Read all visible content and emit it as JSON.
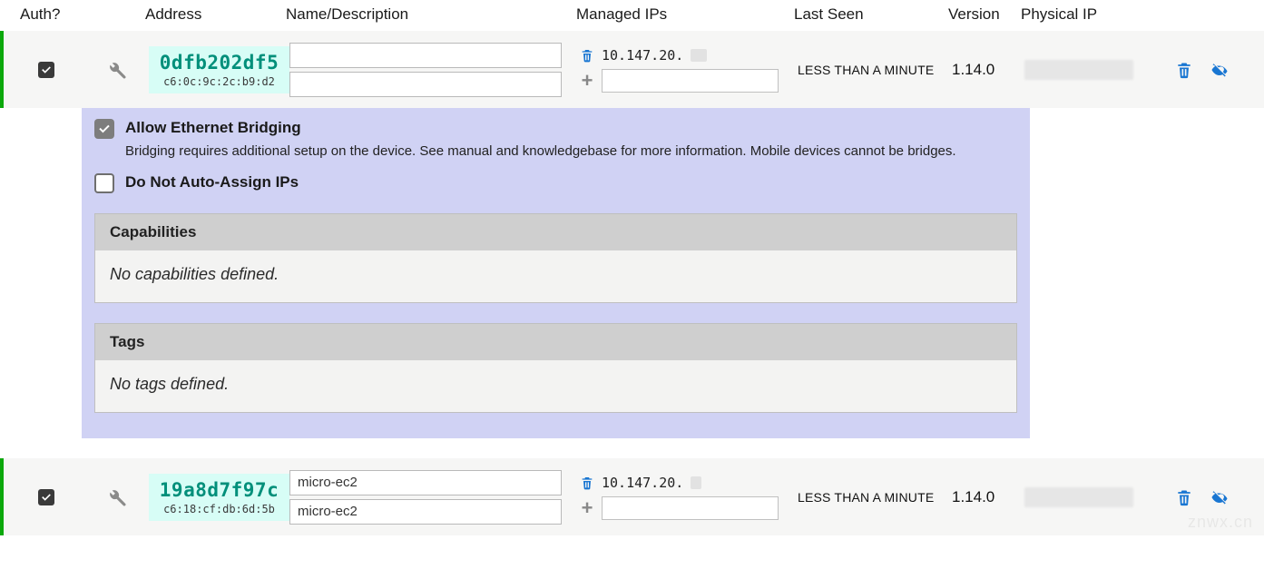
{
  "columns": {
    "auth": "Auth?",
    "address": "Address",
    "name": "Name/Description",
    "ips": "Managed IPs",
    "seen": "Last Seen",
    "version": "Version",
    "physical": "Physical IP"
  },
  "members": [
    {
      "authorized": true,
      "node_id": "0dfb202df5",
      "mac": "c6:0c:9c:2c:b9:d2",
      "name": "",
      "description": "",
      "managed_ips": [
        "10.147.20."
      ],
      "new_ip_value": "",
      "last_seen": "LESS THAN A MINUTE",
      "version": "1.14.0",
      "physical_ip_hidden": true,
      "expanded": true
    },
    {
      "authorized": true,
      "node_id": "19a8d7f97c",
      "mac": "c6:18:cf:db:6d:5b",
      "name": "micro-ec2",
      "description": "micro-ec2",
      "managed_ips": [
        "10.147.20."
      ],
      "new_ip_value": "",
      "last_seen": "LESS THAN A MINUTE",
      "version": "1.14.0",
      "physical_ip_hidden": true,
      "expanded": false
    }
  ],
  "options": {
    "allow_bridging": {
      "checked": true,
      "label": "Allow Ethernet Bridging",
      "help": "Bridging requires additional setup on the device. See manual and knowledgebase for more information. Mobile devices cannot be bridges."
    },
    "no_auto_assign": {
      "checked": false,
      "label": "Do Not Auto-Assign IPs"
    }
  },
  "sections": {
    "capabilities": {
      "title": "Capabilities",
      "empty_text": "No capabilities defined."
    },
    "tags": {
      "title": "Tags",
      "empty_text": "No tags defined."
    }
  },
  "watermark": "znwx.cn"
}
